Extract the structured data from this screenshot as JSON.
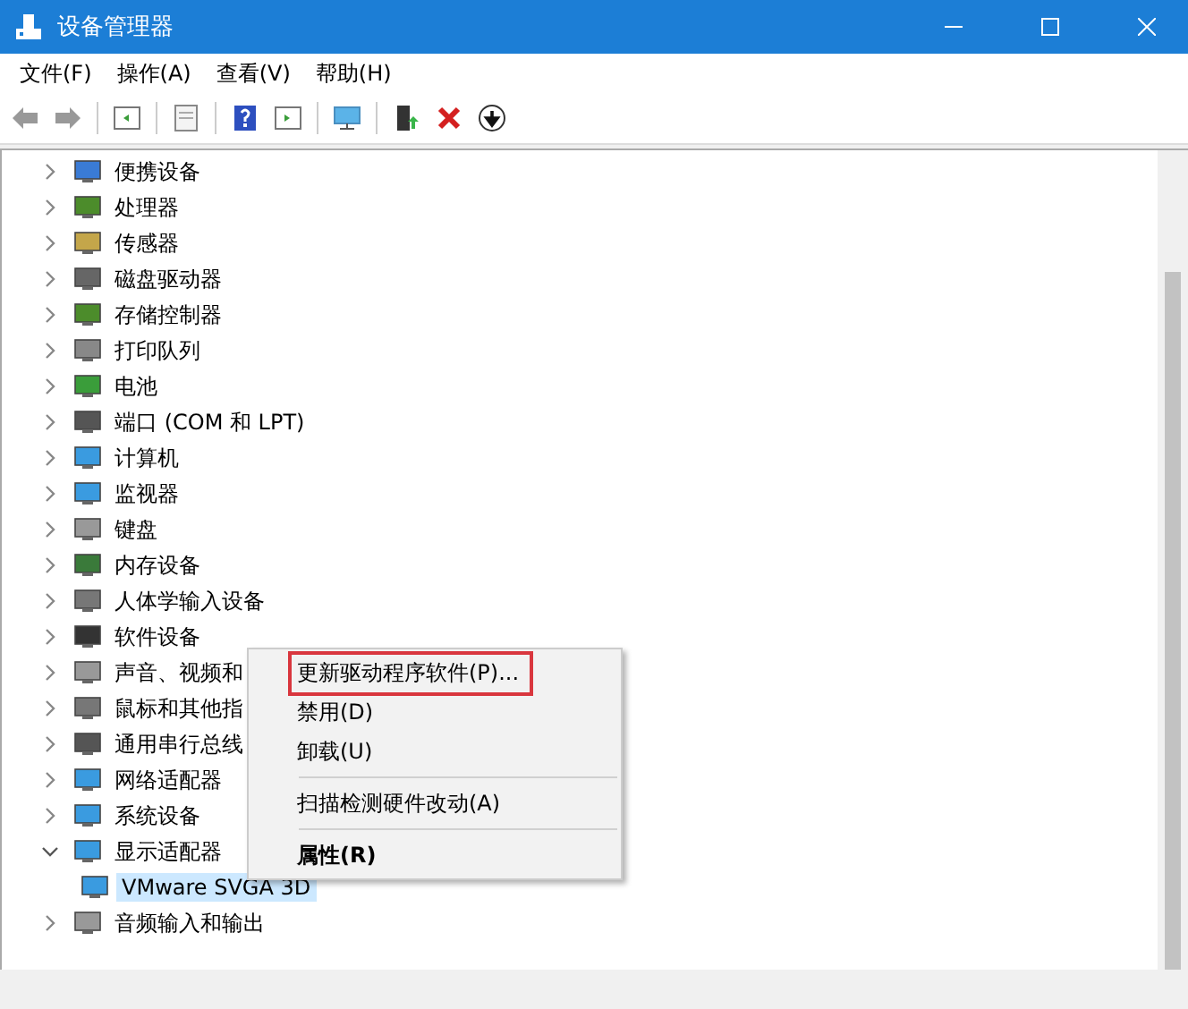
{
  "window": {
    "title": "设备管理器"
  },
  "menu_bar": [
    "文件(F)",
    "操作(A)",
    "查看(V)",
    "帮助(H)"
  ],
  "tree": [
    {
      "label": "便携设备",
      "expanded": false,
      "selected": false
    },
    {
      "label": "处理器",
      "expanded": false,
      "selected": false
    },
    {
      "label": "传感器",
      "expanded": false,
      "selected": false
    },
    {
      "label": "磁盘驱动器",
      "expanded": false,
      "selected": false
    },
    {
      "label": "存储控制器",
      "expanded": false,
      "selected": false
    },
    {
      "label": "打印队列",
      "expanded": false,
      "selected": false
    },
    {
      "label": "电池",
      "expanded": false,
      "selected": false
    },
    {
      "label": "端口 (COM 和 LPT)",
      "expanded": false,
      "selected": false
    },
    {
      "label": "计算机",
      "expanded": false,
      "selected": false
    },
    {
      "label": "监视器",
      "expanded": false,
      "selected": false
    },
    {
      "label": "键盘",
      "expanded": false,
      "selected": false
    },
    {
      "label": "内存设备",
      "expanded": false,
      "selected": false
    },
    {
      "label": "人体学输入设备",
      "expanded": false,
      "selected": false
    },
    {
      "label": "软件设备",
      "expanded": false,
      "selected": false
    },
    {
      "label": "声音、视频和",
      "expanded": false,
      "selected": false
    },
    {
      "label": "鼠标和其他指",
      "expanded": false,
      "selected": false
    },
    {
      "label": "通用串行总线",
      "expanded": false,
      "selected": false
    },
    {
      "label": "网络适配器",
      "expanded": false,
      "selected": false
    },
    {
      "label": "系统设备",
      "expanded": false,
      "selected": false
    },
    {
      "label": "显示适配器",
      "expanded": true,
      "selected": false,
      "children": [
        {
          "label": "VMware SVGA 3D",
          "selected": true
        }
      ]
    },
    {
      "label": "音频输入和输出",
      "expanded": false,
      "selected": false
    }
  ],
  "context_menu": [
    {
      "kind": "item",
      "label": "更新驱动程序软件(P)...",
      "bold": false,
      "highlighted": true
    },
    {
      "kind": "item",
      "label": "禁用(D)",
      "bold": false,
      "highlighted": false
    },
    {
      "kind": "item",
      "label": "卸载(U)",
      "bold": false,
      "highlighted": false
    },
    {
      "kind": "separator"
    },
    {
      "kind": "item",
      "label": "扫描检测硬件改动(A)",
      "bold": false,
      "highlighted": false
    },
    {
      "kind": "separator"
    },
    {
      "kind": "item",
      "label": "属性(R)",
      "bold": true,
      "highlighted": false
    }
  ]
}
